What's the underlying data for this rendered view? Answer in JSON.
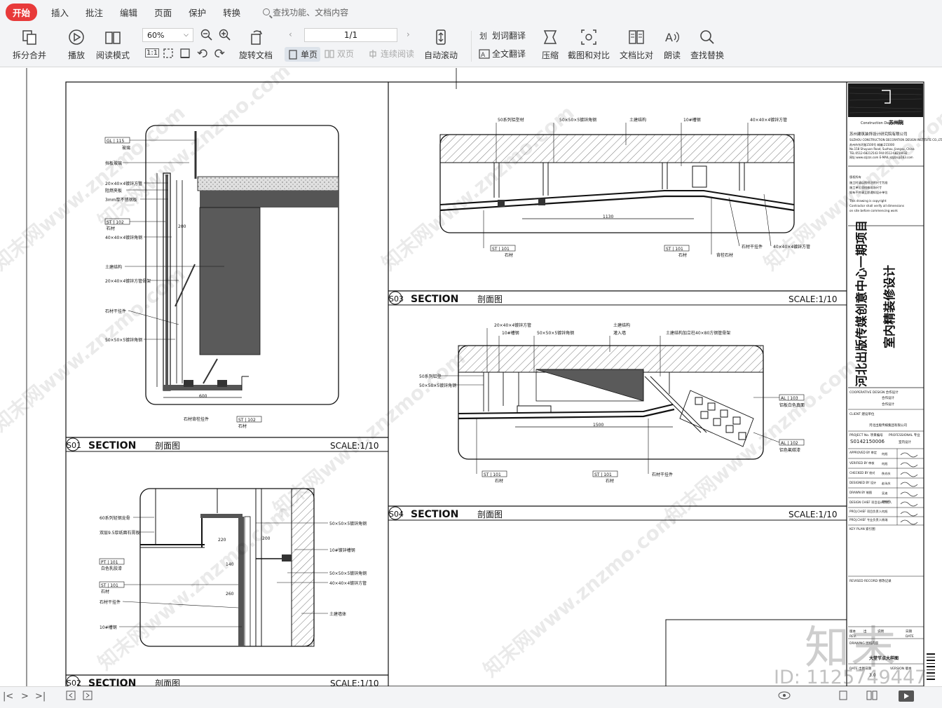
{
  "menubar": {
    "tabs": [
      "开始",
      "插入",
      "批注",
      "编辑",
      "页面",
      "保护",
      "转换"
    ],
    "active_tab": "开始",
    "search_placeholder": "查找功能、文档内容"
  },
  "toolbar": {
    "split_merge": "拆分合并",
    "play": "播放",
    "read_mode": "阅读模式",
    "zoom_value": "60%",
    "actual_size": "1:1",
    "rotate_doc": "旋转文档",
    "page_value": "1/1",
    "single_page": "单页",
    "double_page": "双页",
    "continuous": "连续阅读",
    "auto_scroll": "自动滚动",
    "word_translate": "划词翻译",
    "full_translate": "全文翻译",
    "compress": "压缩",
    "screenshot_compare": "截图和对比",
    "doc_compare": "文档比对",
    "read_aloud": "朗读",
    "find_replace": "查找替换"
  },
  "drawing": {
    "sections": [
      {
        "id": "S01",
        "title": "SECTION",
        "cn": "剖面图",
        "scale": "SCALE:1/10"
      },
      {
        "id": "S03",
        "title": "SECTION",
        "cn": "剖面图",
        "scale": "SCALE:1/10"
      },
      {
        "id": "S04",
        "title": "SECTION",
        "cn": "剖面图",
        "scale": "SCALE:1/10"
      },
      {
        "id": "S02",
        "title": "SECTION",
        "cn": "剖面图",
        "scale": "SCALE:1/10"
      }
    ],
    "project_title_line1": "河北出版传媒创意中心一期项目",
    "project_title_line2": "室内精装修设计",
    "company": "苏州建筑装饰设计研究院有限公司",
    "project_no": "S0142150006",
    "drawing_name": "大堂节点大样图",
    "tags": {
      "gl115": "GL | 115",
      "st102": "ST | 102",
      "st101": "ST | 101",
      "pt101": "PT | 101",
      "al103": "AL | 103",
      "al102": "AL | 102"
    },
    "watermark": "知末网www.znzmo.com"
  },
  "overlay": {
    "brand": "知末",
    "id_text": "ID: 1125749447"
  },
  "colors": {
    "accent_red": "#e83a3a",
    "toolbar_bg": "#f3f4f6",
    "ink": "#111111",
    "fill_dark": "#5a5a5a"
  }
}
